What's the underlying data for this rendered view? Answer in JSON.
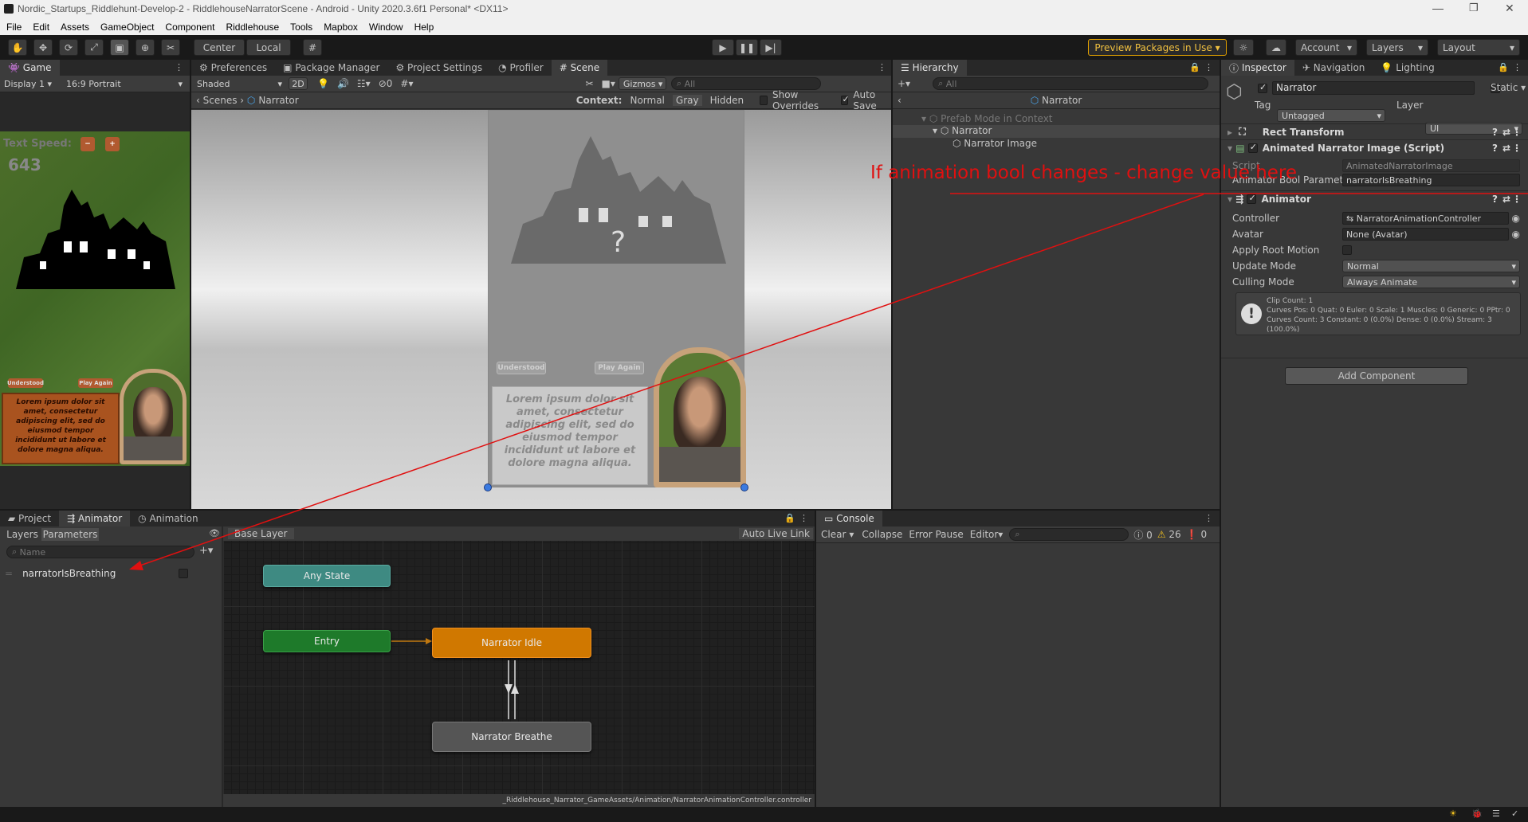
{
  "window": {
    "title": "Nordic_Startups_Riddlehunt-Develop-2 - RiddlehouseNarratorScene - Android - Unity 2020.3.6f1 Personal* <DX11>"
  },
  "menu": [
    "File",
    "Edit",
    "Assets",
    "GameObject",
    "Component",
    "Riddlehouse",
    "Tools",
    "Mapbox",
    "Window",
    "Help"
  ],
  "toolbar": {
    "center": "Center",
    "local": "Local",
    "preview_packages": "Preview Packages in Use",
    "account": "Account",
    "layers": "Layers",
    "layout": "Layout"
  },
  "game": {
    "tab": "Game",
    "display": "Display 1",
    "aspect": "16:9 Portrait",
    "text_speed_label": "Text Speed:",
    "text_speed_value": "643",
    "understood": "Understood",
    "play_again": "Play Again",
    "lorem": "Lorem ipsum dolor sit amet, consectetur adipiscing elit, sed do eiusmod tempor incididunt ut labore et dolore magna aliqua."
  },
  "scene": {
    "tabs": [
      "Preferences",
      "Package Manager",
      "Project Settings",
      "Profiler",
      "Scene"
    ],
    "shaded": "Shaded",
    "mode2d": "2D",
    "gizmos": "Gizmos",
    "search_placeholder": "All",
    "hidden_count": "0",
    "breadcrumb_root": "Scenes",
    "breadcrumb_item": "Narrator",
    "context_label": "Context:",
    "context_normal": "Normal",
    "context_gray": "Gray",
    "context_hidden": "Hidden",
    "show_overrides": "Show Overrides",
    "auto_save": "Auto Save"
  },
  "hierarchy": {
    "tab": "Hierarchy",
    "search_placeholder": "All",
    "header": "Narrator",
    "items": [
      "Prefab Mode in Context",
      "Narrator",
      "Narrator Image"
    ]
  },
  "inspector": {
    "tabs": [
      "Inspector",
      "Navigation",
      "Lighting"
    ],
    "object_name": "Narrator",
    "static_label": "Static",
    "tag_label": "Tag",
    "tag_value": "Untagged",
    "layer_label": "Layer",
    "layer_value": "UI",
    "rect_transform": "Rect Transform",
    "script_component": "Animated Narrator Image (Script)",
    "script_label": "Script",
    "script_value": "AnimatedNarratorImage",
    "bool_label": "Animator Bool Paramete",
    "bool_value": "narratorIsBreathing",
    "animator_component": "Animator",
    "controller_label": "Controller",
    "controller_value": "NarratorAnimationController",
    "avatar_label": "Avatar",
    "avatar_value": "None (Avatar)",
    "root_motion_label": "Apply Root Motion",
    "update_mode_label": "Update Mode",
    "update_mode_value": "Normal",
    "culling_label": "Culling Mode",
    "culling_value": "Always Animate",
    "info_lines": [
      "Clip Count: 1",
      "Curves Pos: 0 Quat: 0 Euler: 0 Scale: 1 Muscles: 0 Generic: 0 PPtr: 0",
      "Curves Count: 3 Constant: 0 (0.0%) Dense: 0 (0.0%) Stream: 3",
      "(100.0%)"
    ],
    "add_component": "Add Component"
  },
  "annotation": {
    "text": "If animation bool changes - change value here",
    "color": "#e01010"
  },
  "animator_panel": {
    "tabs": [
      "Project",
      "Animator",
      "Animation"
    ],
    "layers_tab": "Layers",
    "parameters_tab": "Parameters",
    "name_placeholder": "Name",
    "parameter": "narratorIsBreathing",
    "base_layer": "Base Layer",
    "auto_live_link": "Auto Live Link",
    "nodes": {
      "any_state": "Any State",
      "entry": "Entry",
      "idle": "Narrator Idle",
      "breathe": "Narrator Breathe"
    },
    "path": "_Riddlehouse_Narrator_GameAssets/Animation/NarratorAnimationController.controller"
  },
  "console": {
    "tab": "Console",
    "clear": "Clear",
    "collapse": "Collapse",
    "error_pause": "Error Pause",
    "editor": "Editor",
    "count_info": "0",
    "count_warn": "26",
    "count_error": "0"
  },
  "colors": {
    "any_state": "#3e8a82",
    "entry": "#1e7a2a",
    "idle": "#d07800",
    "breathe": "#555555"
  }
}
